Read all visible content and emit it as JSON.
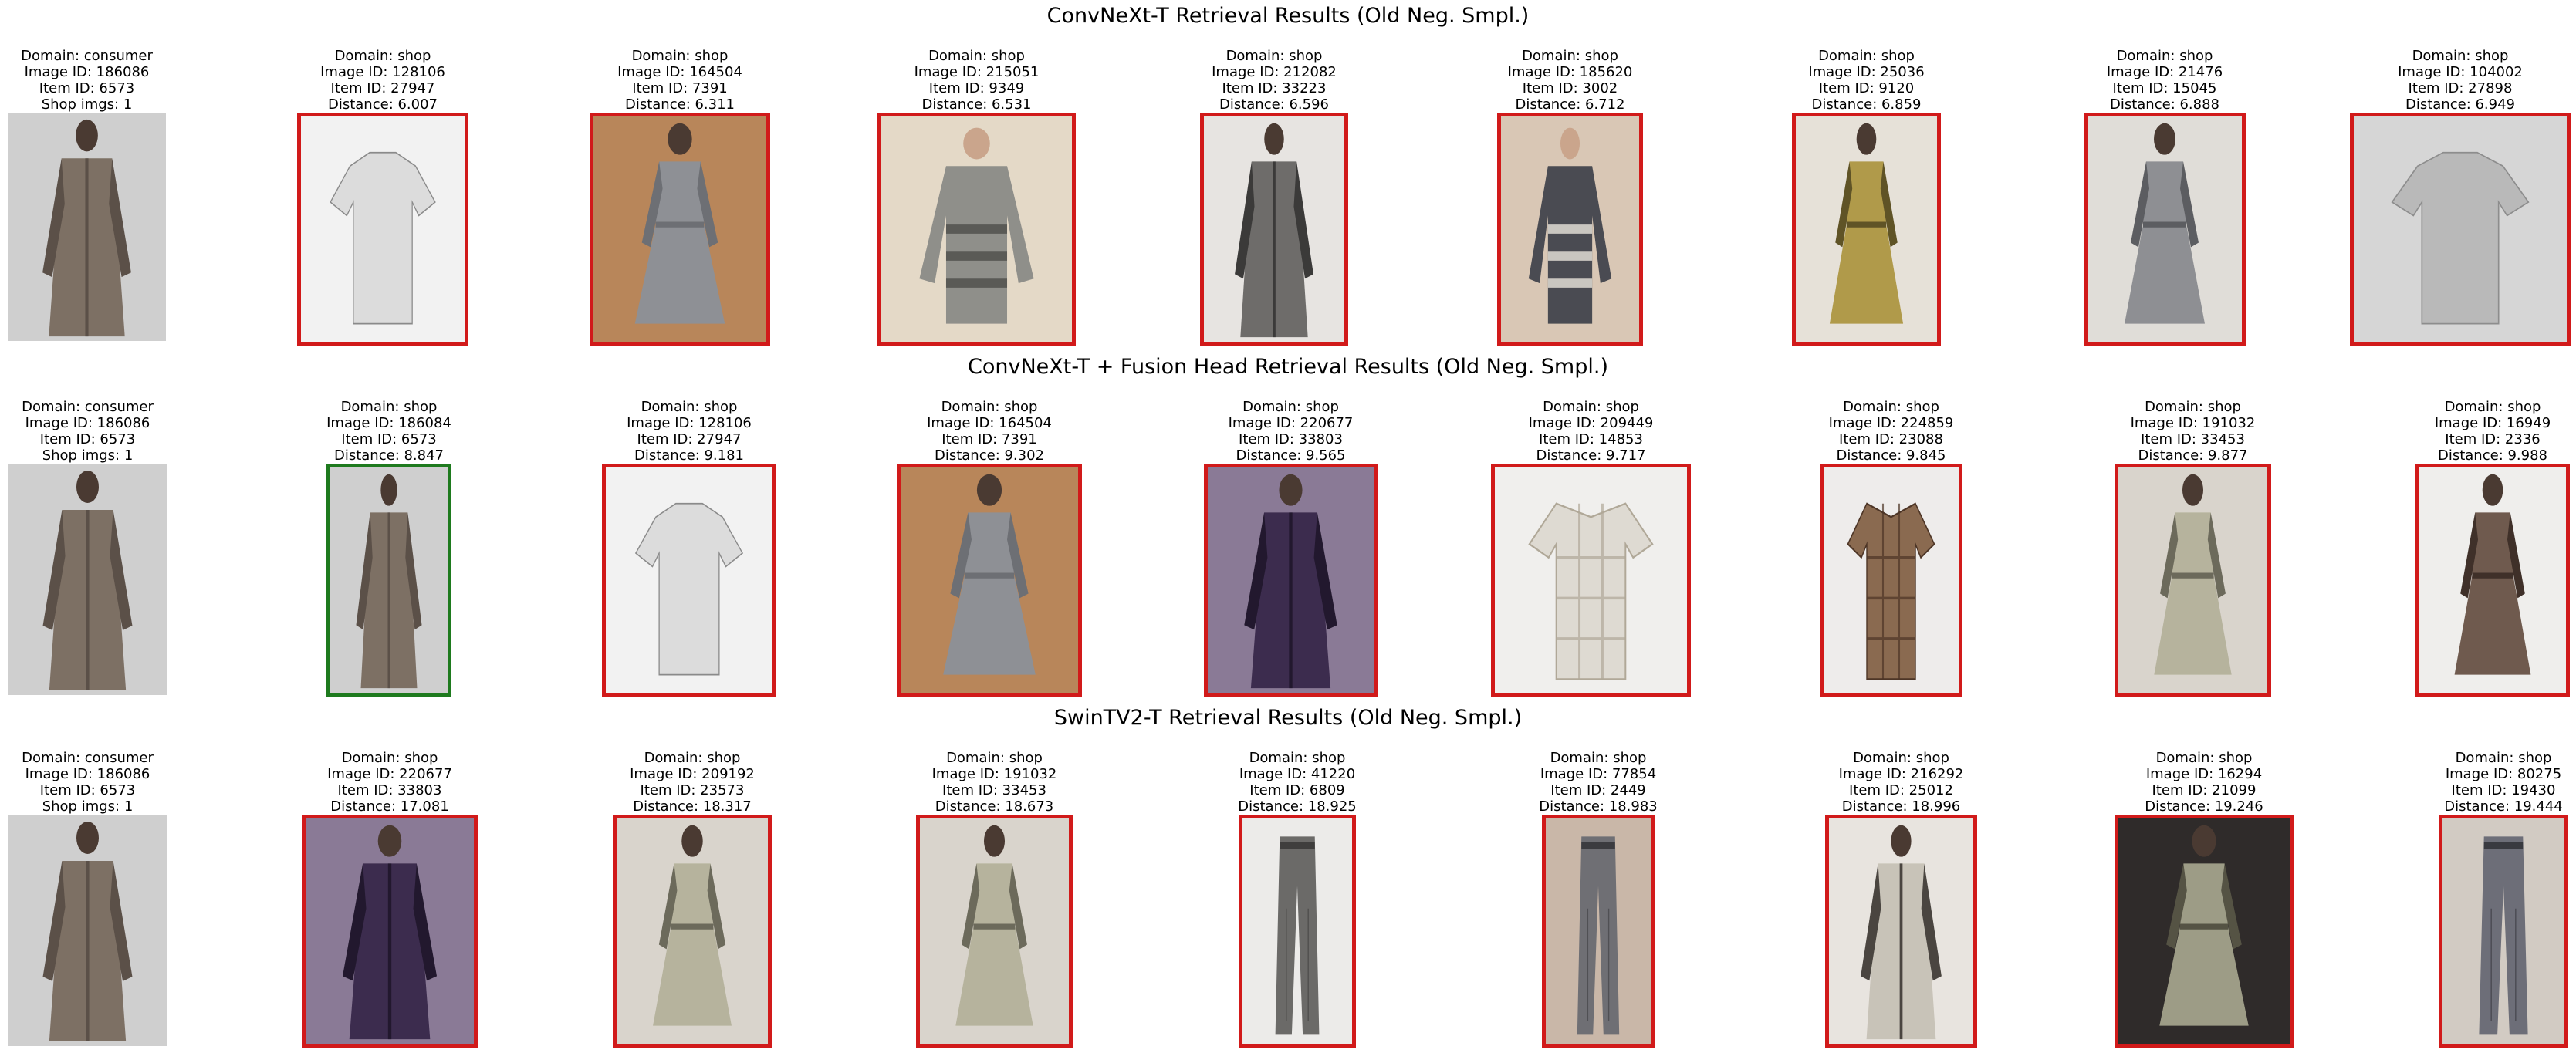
{
  "sections": [
    {
      "title": "ConvNeXt-T Retrieval Results (Old Neg. Smpl.)",
      "query": {
        "domain": "Domain: consumer",
        "image_id": "Image ID: 186086",
        "item_id": "Item ID: 6573",
        "extra": "Shop imgs: 1",
        "garment": "long knit cardigan"
      },
      "results": [
        {
          "domain": "Domain: shop",
          "image_id": "Image ID: 128106",
          "item_id": "Item ID: 27947",
          "distance": "Distance: 6.007",
          "match": false,
          "garment": "white patterned tee"
        },
        {
          "domain": "Domain: shop",
          "image_id": "Image ID: 164504",
          "item_id": "Item ID: 7391",
          "distance": "Distance: 6.311",
          "match": false,
          "garment": "grey knit dress"
        },
        {
          "domain": "Domain: shop",
          "image_id": "Image ID: 215051",
          "item_id": "Item ID: 9349",
          "distance": "Distance: 6.531",
          "match": false,
          "garment": "grey knit sweater"
        },
        {
          "domain": "Domain: shop",
          "image_id": "Image ID: 212082",
          "item_id": "Item ID: 33223",
          "distance": "Distance: 6.596",
          "match": false,
          "garment": "grey cardigan"
        },
        {
          "domain": "Domain: shop",
          "image_id": "Image ID: 185620",
          "item_id": "Item ID: 3002",
          "distance": "Distance: 6.712",
          "match": false,
          "garment": "striped sweater"
        },
        {
          "domain": "Domain: shop",
          "image_id": "Image ID: 25036",
          "item_id": "Item ID: 9120",
          "distance": "Distance: 6.859",
          "match": false,
          "garment": "yellow plaid dress"
        },
        {
          "domain": "Domain: shop",
          "image_id": "Image ID: 21476",
          "item_id": "Item ID: 15045",
          "distance": "Distance: 6.888",
          "match": false,
          "garment": "grey plaid dress"
        },
        {
          "domain": "Domain: shop",
          "image_id": "Image ID: 104002",
          "item_id": "Item ID: 27898",
          "distance": "Distance: 6.949",
          "match": false,
          "garment": "light grey tee"
        }
      ]
    },
    {
      "title": "ConvNeXt-T + Fusion Head Retrieval Results (Old Neg. Smpl.)",
      "query": {
        "domain": "Domain: consumer",
        "image_id": "Image ID: 186086",
        "item_id": "Item ID: 6573",
        "extra": "Shop imgs: 1",
        "garment": "long knit cardigan"
      },
      "results": [
        {
          "domain": "Domain: shop",
          "image_id": "Image ID: 186084",
          "item_id": "Item ID: 6573",
          "distance": "Distance: 8.847",
          "match": true,
          "garment": "long knit cardigan"
        },
        {
          "domain": "Domain: shop",
          "image_id": "Image ID: 128106",
          "item_id": "Item ID: 27947",
          "distance": "Distance: 9.181",
          "match": false,
          "garment": "white patterned tee"
        },
        {
          "domain": "Domain: shop",
          "image_id": "Image ID: 164504",
          "item_id": "Item ID: 7391",
          "distance": "Distance: 9.302",
          "match": false,
          "garment": "grey knit dress"
        },
        {
          "domain": "Domain: shop",
          "image_id": "Image ID: 220677",
          "item_id": "Item ID: 33803",
          "distance": "Distance: 9.565",
          "match": false,
          "garment": "purple lace cardigan"
        },
        {
          "domain": "Domain: shop",
          "image_id": "Image ID: 209449",
          "item_id": "Item ID: 14853",
          "distance": "Distance: 9.717",
          "match": false,
          "garment": "plaid shirt"
        },
        {
          "domain": "Domain: shop",
          "image_id": "Image ID: 224859",
          "item_id": "Item ID: 23088",
          "distance": "Distance: 9.845",
          "match": false,
          "garment": "brown plaid shirt dress"
        },
        {
          "domain": "Domain: shop",
          "image_id": "Image ID: 191032",
          "item_id": "Item ID: 33453",
          "distance": "Distance: 9.877",
          "match": false,
          "garment": "patterned ruffle dress"
        },
        {
          "domain": "Domain: shop",
          "image_id": "Image ID: 16949",
          "item_id": "Item ID: 2336",
          "distance": "Distance: 9.988",
          "match": false,
          "garment": "brown plaid dress"
        }
      ]
    },
    {
      "title": "SwinTV2-T Retrieval Results (Old Neg. Smpl.)",
      "query": {
        "domain": "Domain: consumer",
        "image_id": "Image ID: 186086",
        "item_id": "Item ID: 6573",
        "extra": "Shop imgs: 1",
        "garment": "long knit cardigan"
      },
      "results": [
        {
          "domain": "Domain: shop",
          "image_id": "Image ID: 220677",
          "item_id": "Item ID: 33803",
          "distance": "Distance: 17.081",
          "match": false,
          "garment": "purple lace cardigan"
        },
        {
          "domain": "Domain: shop",
          "image_id": "Image ID: 209192",
          "item_id": "Item ID: 23573",
          "distance": "Distance: 18.317",
          "match": false,
          "garment": "patterned ruffle dress"
        },
        {
          "domain": "Domain: shop",
          "image_id": "Image ID: 191032",
          "item_id": "Item ID: 33453",
          "distance": "Distance: 18.673",
          "match": false,
          "garment": "patterned ruffle dress"
        },
        {
          "domain": "Domain: shop",
          "image_id": "Image ID: 41220",
          "item_id": "Item ID: 6809",
          "distance": "Distance: 18.925",
          "match": false,
          "garment": "grey jogger pants"
        },
        {
          "domain": "Domain: shop",
          "image_id": "Image ID: 77854",
          "item_id": "Item ID: 2449",
          "distance": "Distance: 18.983",
          "match": false,
          "garment": "grey plaid pants"
        },
        {
          "domain": "Domain: shop",
          "image_id": "Image ID: 216292",
          "item_id": "Item ID: 25012",
          "distance": "Distance: 18.996",
          "match": false,
          "garment": "floral kimono"
        },
        {
          "domain": "Domain: shop",
          "image_id": "Image ID: 16294",
          "item_id": "Item ID: 21099",
          "distance": "Distance: 19.246",
          "match": false,
          "garment": "floral maxi dress"
        },
        {
          "domain": "Domain: shop",
          "image_id": "Image ID: 80275",
          "item_id": "Item ID: 19430",
          "distance": "Distance: 19.444",
          "match": false,
          "garment": "plaid pants"
        }
      ]
    }
  ],
  "colors": {
    "match_border": "#1e7a1e",
    "mismatch_border": "#d11a1a"
  }
}
